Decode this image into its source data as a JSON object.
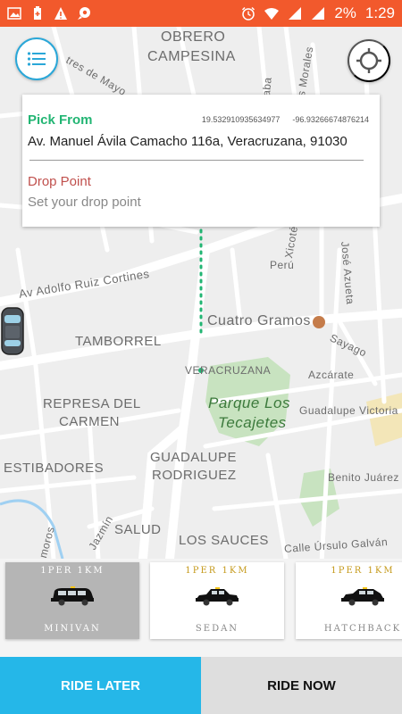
{
  "status_bar": {
    "battery": "2%",
    "time": "1:29",
    "icons": [
      "image-icon",
      "battery-plus-icon",
      "warning-icon",
      "chat-icon",
      "alarm-icon",
      "wifi-icon",
      "signal-icon",
      "signal-icon-2"
    ]
  },
  "map": {
    "labels": {
      "obrero": "OBRERO",
      "campesina": "CAMPESINA",
      "orizaba": "Orizaba",
      "los_morales": "Los Morales",
      "tres_de_mayo": "tres de Mayo",
      "peru": "Perú",
      "xicotencatl": "Xicoténcatl",
      "jose_azueta": "José Azueta",
      "ruiz_cortines": "Av Adolfo Ruiz Cortines",
      "cuatro_gramos": "Cuatro Gramos",
      "tamborrel": "TAMBORREL",
      "veracruzana": "VERACRUZANA",
      "sayago": "Sayago",
      "azucarate": "Azcárate",
      "guadalupe_victoria": "Guadalupe Victoria",
      "parque1": "Parque Los",
      "parque2": "Tecajetes",
      "represa1": "REPRESA DEL",
      "represa2": "CARMEN",
      "estibadores": "ESTIBADORES",
      "guadalupe1": "GUADALUPE",
      "guadalupe2": "RODRIGUEZ",
      "benito": "Benito Juárez",
      "salud": "SALUD",
      "los_sauces": "LOS SAUCES",
      "jazmin": "Jazmín",
      "ursulo": "Calle Úrsulo Galván",
      "amoros": "amoros"
    }
  },
  "location_card": {
    "pick_label": "Pick From",
    "lat": "19.532910935634977",
    "lng": "-96.93266674876214",
    "pick_address": "Av. Manuel Ávila Camacho 116a, Veracruzana, 91030",
    "drop_label": "Drop Point",
    "drop_placeholder": "Set your drop point"
  },
  "vehicles": [
    {
      "rate": "1PER 1KM",
      "name": "MINIVAN",
      "selected": true
    },
    {
      "rate": "1PER 1KM",
      "name": "SEDAN",
      "selected": false
    },
    {
      "rate": "1PER 1KM",
      "name": "HATCHBACK",
      "selected": false
    }
  ],
  "actions": {
    "ride_later": "RIDE LATER",
    "ride_now": "RIDE NOW"
  },
  "colors": {
    "status_bar": "#f2592c",
    "accent": "#25b7e8",
    "pick": "#22b573",
    "drop": "#c0504d",
    "rate": "#c69b1e"
  }
}
